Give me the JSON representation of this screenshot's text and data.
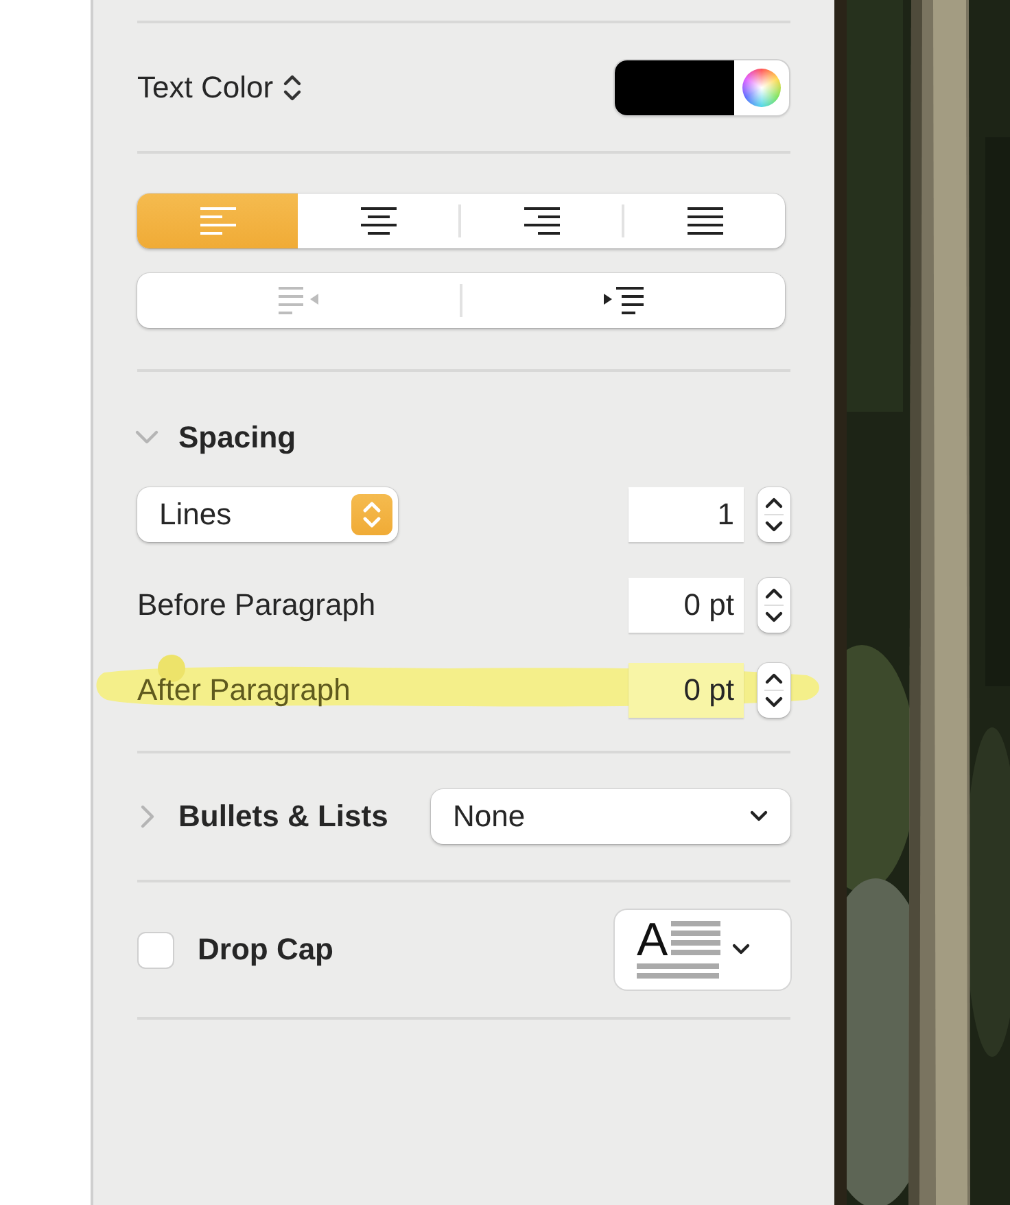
{
  "text_color": {
    "label": "Text Color",
    "color": "#000000"
  },
  "alignment": [
    {
      "kind": "left",
      "selected": true
    },
    {
      "kind": "center",
      "selected": false
    },
    {
      "kind": "right",
      "selected": false
    },
    {
      "kind": "justify",
      "selected": false
    }
  ],
  "indent": [
    {
      "kind": "decrease",
      "disabled": true
    },
    {
      "kind": "increase",
      "disabled": false
    }
  ],
  "spacing": {
    "title": "Spacing",
    "expanded": true,
    "line_mode": "Lines",
    "line_value": "1",
    "rows": [
      {
        "label": "Before Paragraph",
        "value": "0 pt",
        "highlighted": false
      },
      {
        "label": "After Paragraph",
        "value": "0 pt",
        "highlighted": true
      }
    ]
  },
  "bullets": {
    "title": "Bullets & Lists",
    "expanded": false,
    "value": "None"
  },
  "drop_cap": {
    "label": "Drop Cap",
    "checked": false,
    "preview_letter": "A"
  }
}
